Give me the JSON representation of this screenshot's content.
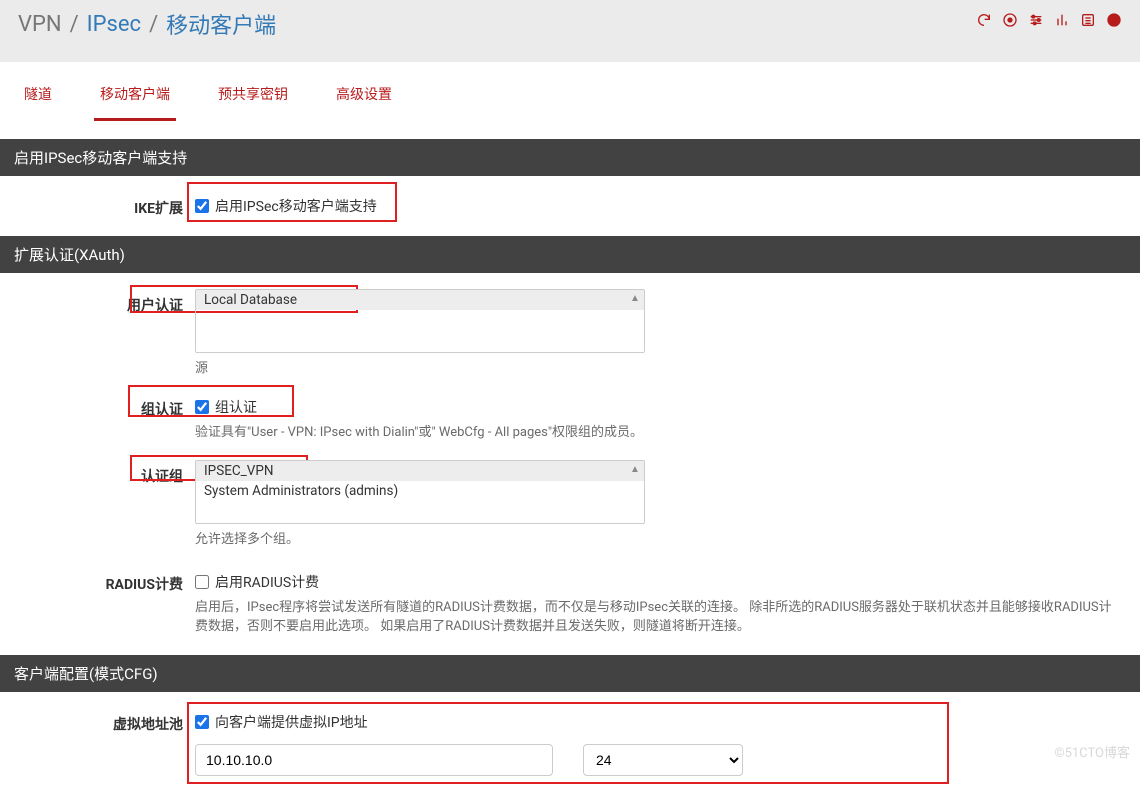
{
  "breadcrumb": {
    "root": "VPN",
    "mid": "IPsec",
    "leaf": "移动客户端"
  },
  "header_icons": [
    {
      "name": "refresh-icon"
    },
    {
      "name": "stop-icon"
    },
    {
      "name": "sliders-icon"
    },
    {
      "name": "chart-icon"
    },
    {
      "name": "list-icon"
    },
    {
      "name": "help-icon"
    }
  ],
  "tabs": [
    {
      "label": "隧道",
      "active": false
    },
    {
      "label": "移动客户端",
      "active": true
    },
    {
      "label": "预共享密钥",
      "active": false
    },
    {
      "label": "高级设置",
      "active": false
    }
  ],
  "panel1": {
    "title": "启用IPSec移动客户端支持",
    "ike_label": "IKE扩展",
    "ike_checkbox_label": "启用IPSec移动客户端支持",
    "ike_checked": true
  },
  "panel2": {
    "title": "扩展认证(XAuth)",
    "user_auth_label": "用户认证",
    "user_auth_options": [
      {
        "text": "Local Database",
        "selected": true
      }
    ],
    "user_auth_help": "源",
    "group_auth_label": "组认证",
    "group_auth_checkbox_label": "组认证",
    "group_auth_checked": true,
    "group_auth_help": "验证具有\"User - VPN: IPsec with Dialin\"或\" WebCfg - All pages\"权限组的成员。",
    "auth_group_label": "认证组",
    "auth_group_options": [
      {
        "text": "IPSEC_VPN",
        "selected": true
      },
      {
        "text": "System Administrators (admins)",
        "selected": false
      }
    ],
    "auth_group_help": "允许选择多个组。",
    "radius_label": "RADIUS计费",
    "radius_checkbox_label": "启用RADIUS计费",
    "radius_checked": false,
    "radius_help": "启用后，IPsec程序将尝试发送所有隧道的RADIUS计费数据，而不仅是与移动IPsec关联的连接。 除非所选的RADIUS服务器处于联机状态并且能够接收RADIUS计费数据，否则不要启用此选项。 如果启用了RADIUS计费数据并且发送失败，则隧道将断开连接。"
  },
  "panel3": {
    "title": "客户端配置(模式CFG)",
    "pool_label": "虚拟地址池",
    "pool_checkbox_label": "向客户端提供虚拟IP地址",
    "pool_checked": true,
    "pool_ip": "10.10.10.0",
    "pool_mask": "24"
  },
  "watermark": "©51CTO博客"
}
